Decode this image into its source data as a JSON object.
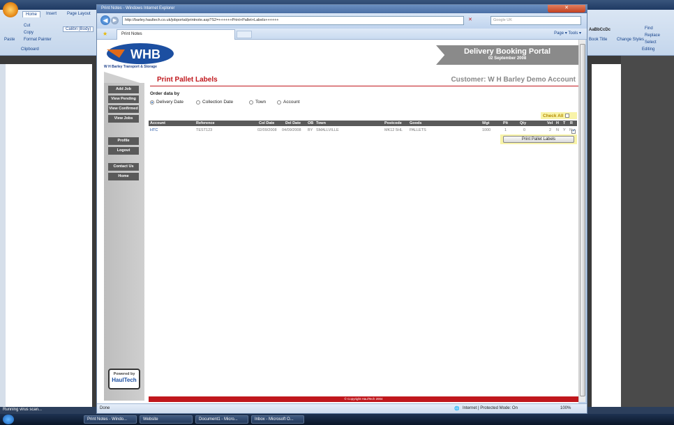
{
  "word": {
    "tabs": [
      "Home",
      "Insert",
      "Page Layout"
    ],
    "clipboard": {
      "cut": "Cut",
      "copy": "Copy",
      "format_painter": "Format Painter",
      "paste": "Paste",
      "group": "Clipboard"
    },
    "font_name": "Calibri (Body)",
    "styles": {
      "sample": "AaBbCcDc",
      "label": "Book Title",
      "change_styles": "Change Styles"
    },
    "editing": {
      "find": "Find",
      "replace": "Replace",
      "select": "Select",
      "group": "Editing"
    },
    "status": "Running virus scan..."
  },
  "taskbar": {
    "items": [
      "Print Notes - Windo...",
      "Website",
      "Document1 - Micro...",
      "Inbox - Microsoft O..."
    ]
  },
  "ie": {
    "title": "Print Notes - Windows Internet Explorer",
    "url": "http://barley.haultech.co.uk/jobportal/printnote.asp?S2=++++++Print+Pallet+Labels++++++",
    "search_placeholder": "Google UK",
    "tab_title": "Print Notes",
    "commands": "Page ▾  Tools ▾",
    "status_left": "Done",
    "status_zone": "Internet | Protected Mode: On",
    "zoom": "100%"
  },
  "page": {
    "logo_text": "WHB",
    "logo_sub": "W H Barley Transport & Storage",
    "portal_title": "Delivery Booking Portal",
    "portal_date": "02 September 2008",
    "nav": [
      "Add Job",
      "View Pending",
      "View Confirmed",
      "View Jobs",
      "Profile",
      "Logout",
      "Contact Us",
      "Home"
    ],
    "powered_by": "Powered by",
    "powered_brand": "HaulTech",
    "title": "Print Pallet Labels",
    "customer": "Customer: W H Barley Demo Account",
    "order_label": "Order data by",
    "order_options": [
      "Delivery Date",
      "Collection Date",
      "Town",
      "Account"
    ],
    "order_selected": "Delivery Date",
    "check_all": "Check All",
    "columns": [
      "Account",
      "Reference",
      "Col Date",
      "Del Date",
      "OB",
      "Town",
      "Postcode",
      "Goods",
      "Wgt",
      "Plt",
      "Qty",
      "Vol",
      "H",
      "T",
      "R"
    ],
    "rows": [
      {
        "account": "HTC",
        "reference": "TEST123",
        "col_date": "02/09/2008",
        "del_date": "04/09/2008",
        "ob": "BY",
        "town": "SMALLVILLE",
        "postcode": "MK12 5HL",
        "goods": "PALLETS",
        "wgt": "1000",
        "plt": "1",
        "qty": "0",
        "vol": "2",
        "h": "N",
        "t": "Y",
        "r": "N",
        "checked": true
      }
    ],
    "print_button": "Print Pallet Labels",
    "footer": "© Copyright  HaulTech 2004"
  },
  "colors": {
    "brand_red": "#c0171c",
    "brand_blue": "#1c4fa1",
    "nav_grey": "#5a5a5a",
    "highlight": "#f8f3a8"
  }
}
